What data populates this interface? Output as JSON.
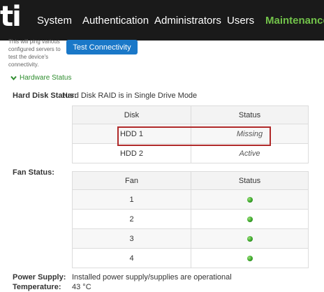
{
  "nav": {
    "logo": "ti",
    "items": [
      "System",
      "Authentication",
      "Administrators",
      "Users",
      "Maintenance"
    ],
    "active": "Maintenance"
  },
  "connectivity": {
    "description": "This will ping various configured servers to test the device's connectivity.",
    "button_label": "Test Connectivity"
  },
  "hardware_status": {
    "section_title": "Hardware Status",
    "hard_disk": {
      "label": "Hard Disk Status:",
      "value": "Hard Disk RAID is in Single Drive Mode",
      "columns": [
        "Disk",
        "Status"
      ],
      "rows": [
        {
          "disk": "HDD 1",
          "status": "Missing"
        },
        {
          "disk": "HDD 2",
          "status": "Active"
        }
      ]
    },
    "fan": {
      "label": "Fan Status:",
      "columns": [
        "Fan",
        "Status"
      ],
      "rows": [
        {
          "fan": "1",
          "status_icon": "green-status-dot"
        },
        {
          "fan": "2",
          "status_icon": "green-status-dot"
        },
        {
          "fan": "3",
          "status_icon": "green-status-dot"
        },
        {
          "fan": "4",
          "status_icon": "green-status-dot"
        }
      ]
    },
    "power_supply": {
      "label": "Power Supply:",
      "value": "Installed power supply/supplies are operational"
    },
    "temperature": {
      "label": "Temperature:",
      "value": "43 °C"
    }
  },
  "colors": {
    "nav_bg": "#1a1a1a",
    "active_nav": "#72c24a",
    "button": "#1a78c8",
    "section_title": "#2f8d2f",
    "highlight": "#b02a2a",
    "status_ok": "#3aa52a"
  }
}
